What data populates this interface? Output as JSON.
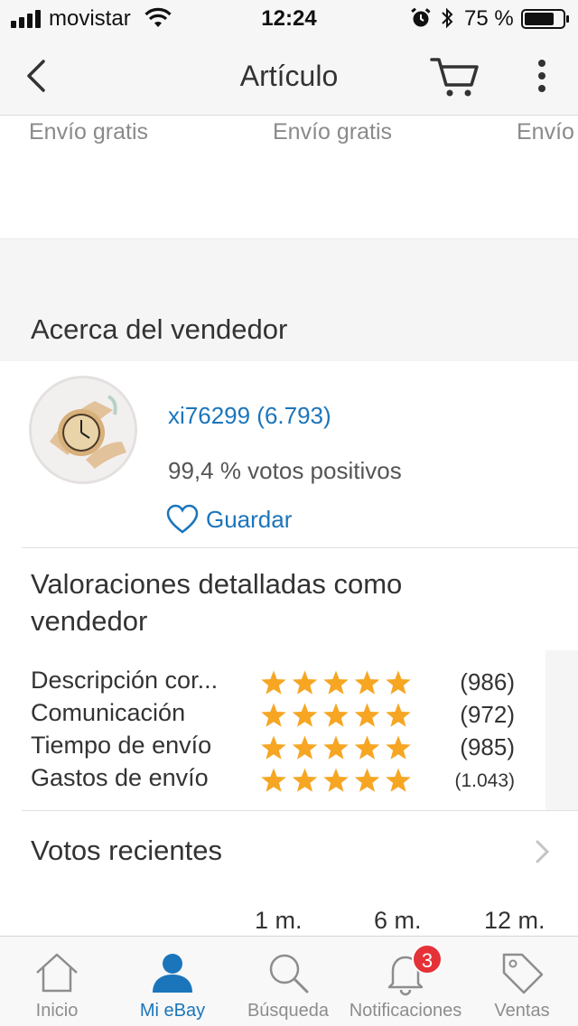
{
  "status_bar": {
    "carrier": "movistar",
    "time": "12:24",
    "battery_text": "75 %"
  },
  "nav": {
    "title": "Artículo"
  },
  "shipping": [
    "Envío gratis",
    "Envío gratis",
    "Envío"
  ],
  "seller_section": {
    "title": "Acerca del vendedor",
    "name": "xi76299 (6.793)",
    "positive": "99,4 % votos positivos",
    "save_label": "Guardar"
  },
  "ratings": {
    "title": "Valoraciones detalladas como vendedor",
    "rows": [
      {
        "label": "Descripción cor...",
        "stars": 5,
        "count": "(986)"
      },
      {
        "label": "Comunicación",
        "stars": 5,
        "count": "(972)"
      },
      {
        "label": "Tiempo de envío",
        "stars": 5,
        "count": "(985)"
      },
      {
        "label": "Gastos de envío",
        "stars": 5,
        "count": "(1.043)"
      }
    ],
    "star_color": "#f6a623"
  },
  "recent": {
    "title": "Votos recientes",
    "periods": [
      "1 m.",
      "6 m.",
      "12 m."
    ]
  },
  "tabbar": {
    "tabs": [
      {
        "label": "Inicio",
        "icon": "home-icon"
      },
      {
        "label": "Mi eBay",
        "icon": "person-icon"
      },
      {
        "label": "Búsqueda",
        "icon": "search-icon"
      },
      {
        "label": "Notificaciones",
        "icon": "bell-icon"
      },
      {
        "label": "Ventas",
        "icon": "tag-icon"
      }
    ],
    "notifications_badge": "3",
    "active_color": "#1b75bb"
  }
}
